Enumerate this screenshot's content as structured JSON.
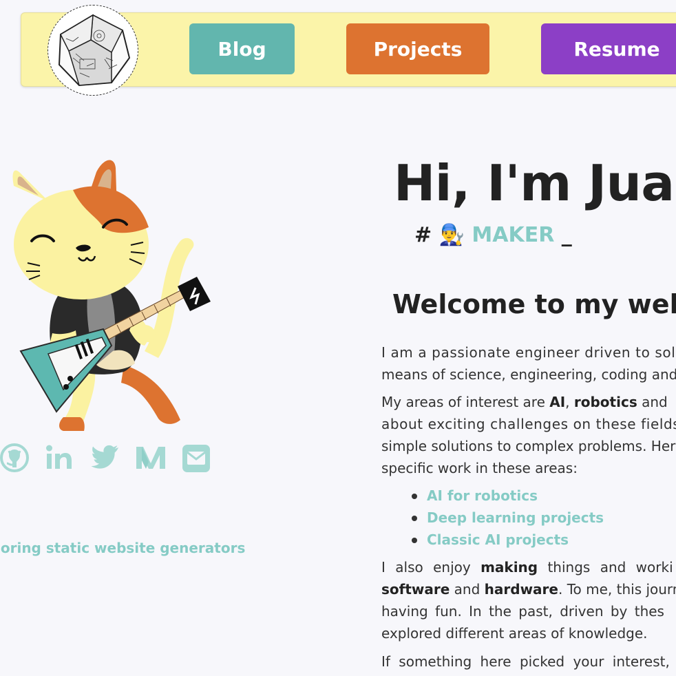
{
  "nav": {
    "blog_label": "Blog",
    "projects_label": "Projects",
    "resume_label": "Resume",
    "colors": {
      "background": "#fbf4a9",
      "blog": "#62b6ae",
      "projects": "#dd7330",
      "resume": "#8c3fc6"
    }
  },
  "socials": [
    {
      "icon": "github-icon"
    },
    {
      "icon": "linkedin-icon"
    },
    {
      "icon": "twitter-icon"
    },
    {
      "icon": "medium-icon"
    },
    {
      "icon": "email-icon"
    }
  ],
  "side_link": "loring static website generators",
  "hero": {
    "title": "Hi, I'm Juan",
    "tag_hash": "#",
    "tag_emoji": "👨‍🔧",
    "tag_word": "MAKER",
    "tag_cursor": "_"
  },
  "welcome": "Welcome to my webs",
  "p1": {
    "l1": "I am a passionate engineer driven to sol",
    "l2": "means of science, engineering, coding and"
  },
  "p2": {
    "l1a": "My areas of interest are ",
    "l1b": "AI",
    "l1c": ", ",
    "l1d": "robotics",
    "l1e": " and",
    "l2": "about exciting challenges on these fields",
    "l3": "simple solutions to complex problems. Her",
    "l4": "specific work in these areas:"
  },
  "links": [
    "AI for robotics",
    "Deep learning projects",
    "Classic AI projects"
  ],
  "p3": {
    "l1a": "I also enjoy ",
    "l1b": "making",
    "l1c": " things and worki",
    "l2a": "software",
    "l2b": " and ",
    "l2c": "hardware",
    "l2d": ". To me, this journ",
    "l3": "having fun. In the past, driven by thes",
    "l4": "explored different areas of knowledge."
  },
  "p4": {
    "l1": "If something here picked your interest,"
  },
  "accent_color": "#85cbc5"
}
